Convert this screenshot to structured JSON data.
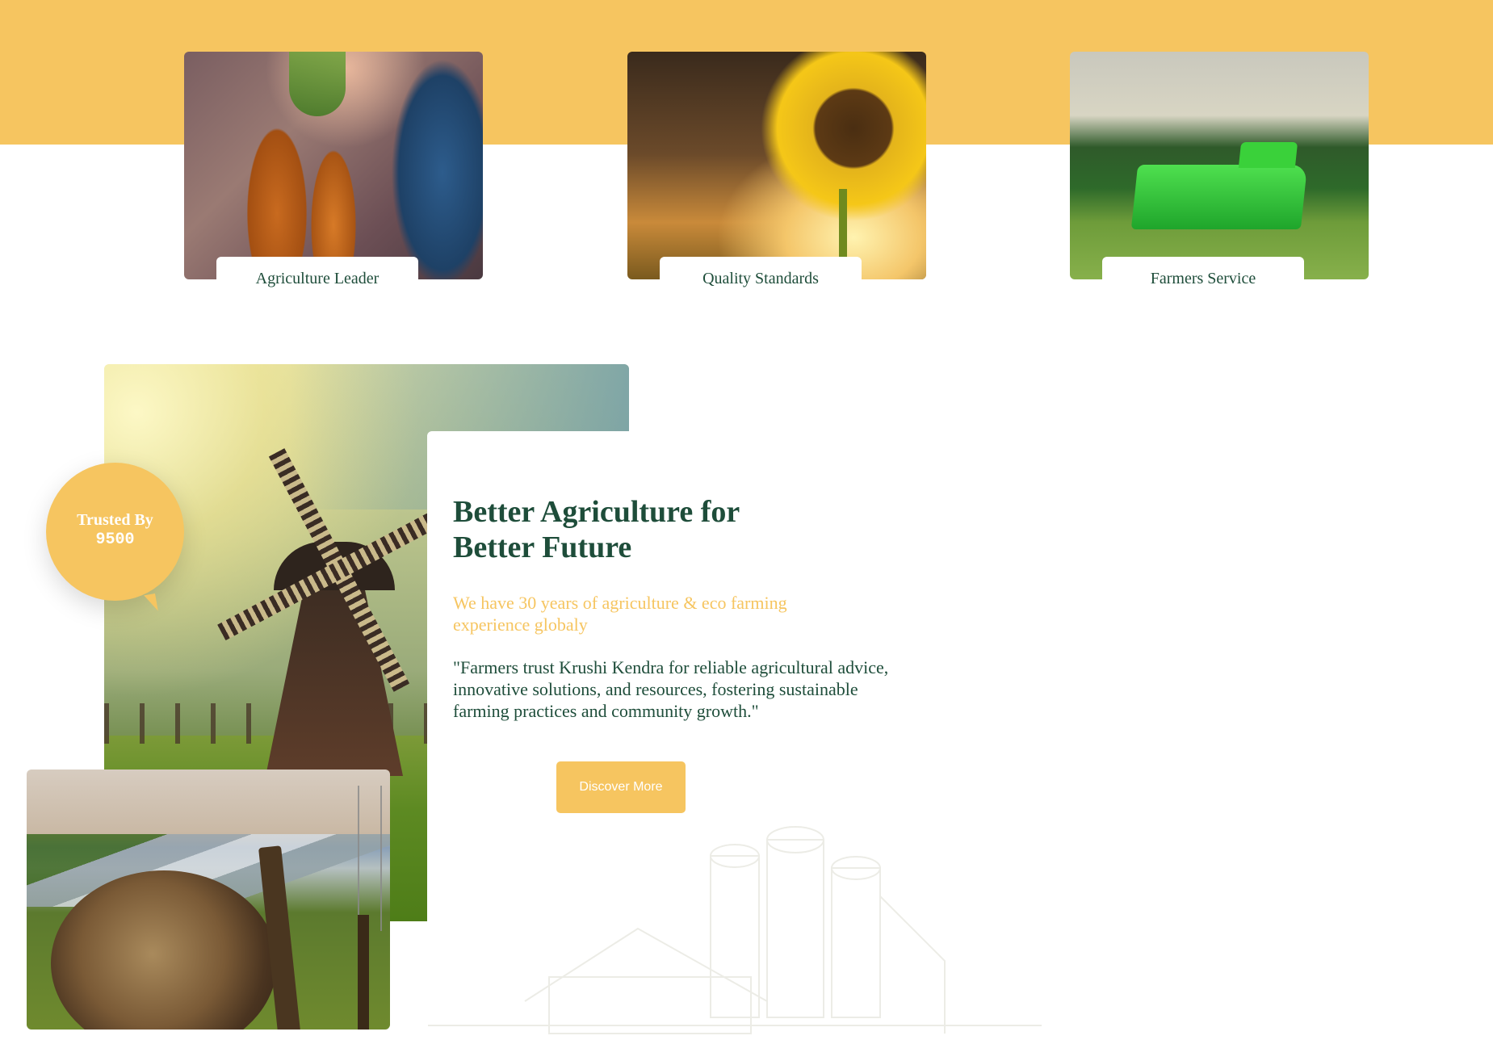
{
  "features": [
    {
      "label": "Agriculture Leader",
      "image": "carrots-photo"
    },
    {
      "label": "Quality Standards",
      "image": "sunflower-photo"
    },
    {
      "label": "Farmers Service",
      "image": "harvester-photo"
    }
  ],
  "about": {
    "badge": {
      "title": "Trusted By",
      "count": "9500"
    },
    "headline_line1": "Better Agriculture for",
    "headline_line2": "Better Future",
    "subline": "We have 30 years of agriculture & eco farming experience globaly",
    "quote": "\"Farmers trust Krushi Kendra for reliable agricultural advice, innovative solutions, and resources, fostering sustainable farming practices and community growth.\"",
    "cta_label": "Discover More"
  },
  "colors": {
    "accent": "#f6c560",
    "heading": "#1e4d3a",
    "background": "#ffffff"
  }
}
